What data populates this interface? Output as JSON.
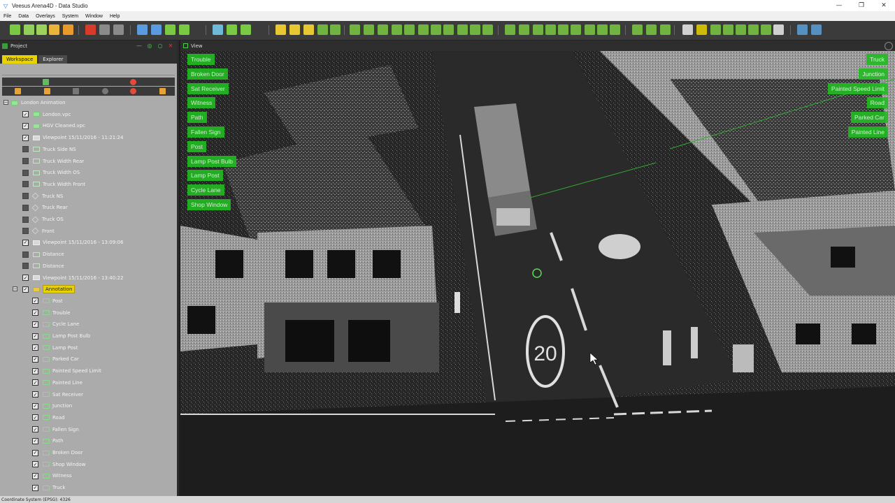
{
  "window": {
    "title": "Veesus Arena4D - Data Studio",
    "controls": [
      "—",
      "❐",
      "✕"
    ]
  },
  "menu": [
    "File",
    "Data",
    "Overlays",
    "System",
    "Window",
    "Help"
  ],
  "project_panel": {
    "title": "Project",
    "tabs": [
      "Workspace",
      "Explorer"
    ],
    "active_tab": "Workspace"
  },
  "tree": [
    {
      "label": "London Animation",
      "level": 0,
      "expander": "⊟",
      "icon": "cloud",
      "checkbox": null,
      "highlight": false
    },
    {
      "label": "London.vpc",
      "level": 1,
      "icon": "cloud",
      "checkbox": "on",
      "highlight": false
    },
    {
      "label": "HGV Cleaned.vpc",
      "level": 1,
      "icon": "cloud",
      "checkbox": "on",
      "highlight": false
    },
    {
      "label": "Viewpoint 15/11/2016 - 11:21:24",
      "level": 1,
      "icon": "view",
      "checkbox": "on",
      "highlight": false
    },
    {
      "label": "Truck Side NS",
      "level": 1,
      "icon": "box",
      "checkbox": "off",
      "highlight": false
    },
    {
      "label": "Truck Width Rear",
      "level": 1,
      "icon": "box",
      "checkbox": "off",
      "highlight": false
    },
    {
      "label": "Truck Width OS",
      "level": 1,
      "icon": "box",
      "checkbox": "off",
      "highlight": false
    },
    {
      "label": "Truck Width Front",
      "level": 1,
      "icon": "box",
      "checkbox": "off",
      "highlight": false
    },
    {
      "label": "Truck NS",
      "level": 1,
      "icon": "diamond",
      "checkbox": "off",
      "highlight": false
    },
    {
      "label": "Truck Rear",
      "level": 1,
      "icon": "diamond",
      "checkbox": "off",
      "highlight": false
    },
    {
      "label": "Truck OS",
      "level": 1,
      "icon": "diamond",
      "checkbox": "off",
      "highlight": false
    },
    {
      "label": "Front",
      "level": 1,
      "icon": "diamond",
      "checkbox": "off",
      "highlight": false
    },
    {
      "label": "Viewpoint 15/11/2016 - 13:09:06",
      "level": 1,
      "icon": "view",
      "checkbox": "on",
      "highlight": false
    },
    {
      "label": "Distance",
      "level": 1,
      "icon": "box",
      "checkbox": "off",
      "highlight": false
    },
    {
      "label": "Distance",
      "level": 1,
      "icon": "box",
      "checkbox": "off",
      "highlight": false
    },
    {
      "label": "Viewpoint 15/11/2016 - 13:40:22",
      "level": 1,
      "icon": "view",
      "checkbox": "on",
      "highlight": false
    },
    {
      "label": "Annotation",
      "level": 1,
      "expander": "⊟",
      "icon": "folder",
      "checkbox": "on",
      "highlight": true
    },
    {
      "label": "Post",
      "level": 2,
      "icon": "tag",
      "checkbox": "on",
      "highlight": false
    },
    {
      "label": "Trouble",
      "level": 2,
      "icon": "tag",
      "checkbox": "on",
      "highlight": false
    },
    {
      "label": "Cycle Lane",
      "level": 2,
      "icon": "tag",
      "checkbox": "on",
      "highlight": false
    },
    {
      "label": "Lamp Post Bulb",
      "level": 2,
      "icon": "tag",
      "checkbox": "on",
      "highlight": false
    },
    {
      "label": "Lamp Post",
      "level": 2,
      "icon": "tag",
      "checkbox": "on",
      "highlight": false
    },
    {
      "label": "Parked Car",
      "level": 2,
      "icon": "tag",
      "checkbox": "on",
      "highlight": false
    },
    {
      "label": "Painted Speed Limit",
      "level": 2,
      "icon": "tag",
      "checkbox": "on",
      "highlight": false
    },
    {
      "label": "Painted Line",
      "level": 2,
      "icon": "tag",
      "checkbox": "on",
      "highlight": false
    },
    {
      "label": "Sat Receiver",
      "level": 2,
      "icon": "tag",
      "checkbox": "on",
      "highlight": false
    },
    {
      "label": "Junction",
      "level": 2,
      "icon": "tag",
      "checkbox": "on",
      "highlight": false
    },
    {
      "label": "Road",
      "level": 2,
      "icon": "tag",
      "checkbox": "on",
      "highlight": false
    },
    {
      "label": "Fallen Sign",
      "level": 2,
      "icon": "tag",
      "checkbox": "on",
      "highlight": false
    },
    {
      "label": "Path",
      "level": 2,
      "icon": "tag",
      "checkbox": "on",
      "highlight": false
    },
    {
      "label": "Broken Door",
      "level": 2,
      "icon": "tag",
      "checkbox": "on",
      "highlight": false
    },
    {
      "label": "Shop Window",
      "level": 2,
      "icon": "tag",
      "checkbox": "on",
      "highlight": false
    },
    {
      "label": "Witness",
      "level": 2,
      "icon": "tag",
      "checkbox": "on",
      "highlight": false
    },
    {
      "label": "Truck",
      "level": 2,
      "icon": "tag",
      "checkbox": "on",
      "highlight": false
    }
  ],
  "view_panel": {
    "title": "View",
    "left_tags": [
      "Trouble",
      "Broken Door",
      "Sat Receiver",
      "Witness",
      "Path",
      "Fallen Sign",
      "Post",
      "Lamp Post Bulb",
      "Lamp Post",
      "Cycle Lane",
      "Shop Window"
    ],
    "right_tags": [
      "Truck",
      "Junction",
      "Painted Speed Limit",
      "Road",
      "Parked Car",
      "Painted Line"
    ],
    "road_marking": "20"
  },
  "status": {
    "text": "Coordinate System (EPSG): 4326"
  },
  "colors": {
    "highlight": "#e8d200",
    "tag_green": "#22bb22",
    "panel_bg": "#ababab",
    "dark": "#2e2e2e"
  },
  "toolbar_icons": [
    "new",
    "open",
    "save",
    "export",
    "print",
    "stop",
    "undo",
    "redo",
    "camera",
    "measure",
    "layers",
    "settings",
    "annotate",
    "zoom",
    "help",
    "grid",
    "view-front",
    "view-top",
    "fullscreen",
    "window-layout"
  ]
}
